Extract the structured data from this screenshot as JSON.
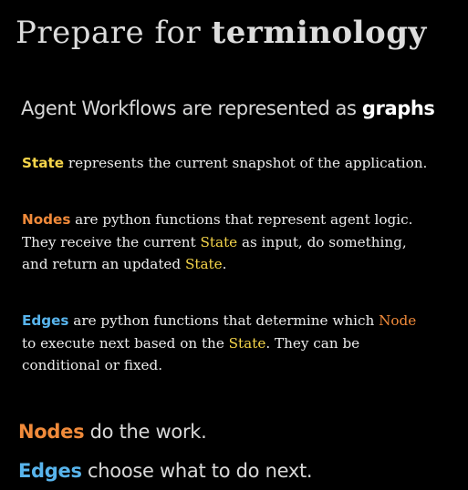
{
  "title": {
    "prefix": "Prepare for ",
    "bold": "terminology"
  },
  "subtitle": {
    "prefix": "Agent Workflows are represented as ",
    "bold": "graphs"
  },
  "state_paragraph": {
    "term": "State",
    "rest": " represents the current snapshot of the application."
  },
  "nodes_paragraph": {
    "term": "Nodes",
    "line1_rest": " are python functions that represent agent logic.",
    "line2_a": "They receive the current ",
    "line2_state": "State",
    "line2_b": " as input, do something,",
    "line3_a": "and return an updated ",
    "line3_state": "State",
    "line3_b": "."
  },
  "edges_paragraph": {
    "term": "Edges",
    "line1_rest": " are python functions that determine which ",
    "line1_node": "Node",
    "line2_a": "to execute next based on the ",
    "line2_state": "State",
    "line2_b": ". They can be",
    "line3": "conditional or fixed."
  },
  "summary": {
    "nodes_term": "Nodes",
    "nodes_rest": " do the work.",
    "edges_term": "Edges",
    "edges_rest": " choose what to do next."
  },
  "colors": {
    "background": "#000000",
    "state": "#f5d54a",
    "node": "#f08a3a",
    "edge": "#58b4ec",
    "text": "#ececec"
  }
}
